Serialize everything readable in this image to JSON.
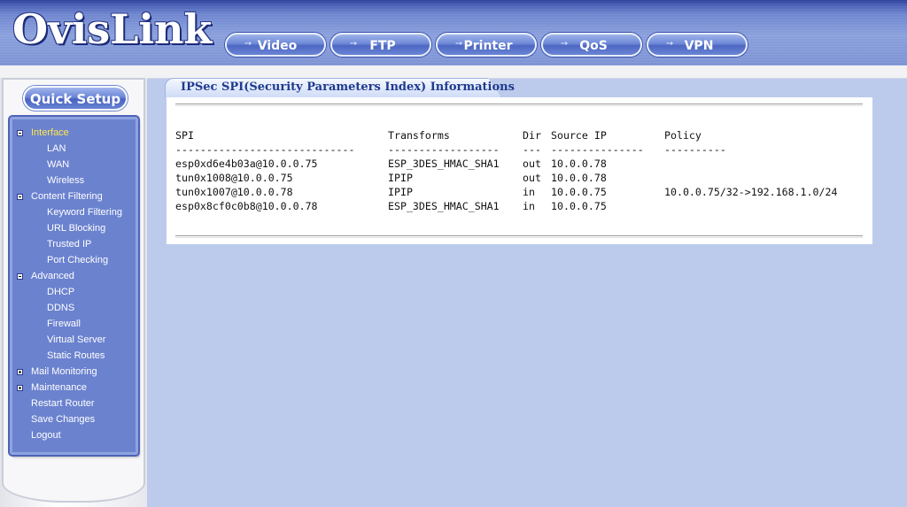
{
  "header": {
    "logo": "OvisLink",
    "nav": [
      {
        "label": "Video"
      },
      {
        "label": "FTP"
      },
      {
        "label": "Printer"
      },
      {
        "label": "QoS"
      },
      {
        "label": "VPN"
      }
    ]
  },
  "sidebar": {
    "quick_setup": "Quick Setup",
    "groups": {
      "interface": {
        "label": "Interface",
        "items": [
          "LAN",
          "WAN",
          "Wireless"
        ]
      },
      "content_filtering": {
        "label": "Content Filtering",
        "items": [
          "Keyword Filtering",
          "URL Blocking",
          "Trusted IP",
          "Port Checking"
        ]
      },
      "advanced": {
        "label": "Advanced",
        "items": [
          "DHCP",
          "DDNS",
          "Firewall",
          "Virtual Server",
          "Static Routes"
        ]
      },
      "mail_monitoring": {
        "label": "Mail Monitoring"
      },
      "maintenance": {
        "label": "Maintenance"
      }
    },
    "actions": [
      "Restart Router",
      "Save Changes",
      "Logout"
    ]
  },
  "main": {
    "title": "IPSec SPI(Security Parameters Index) Informations",
    "table": {
      "headers": {
        "spi": "SPI",
        "transforms": "Transforms",
        "dir": "Dir",
        "source_ip": "Source IP",
        "policy": "Policy"
      },
      "separators": {
        "spi": "-----------------------------",
        "transforms": "------------------",
        "dir": "---",
        "source_ip": "---------------",
        "policy": "----------"
      },
      "rows": [
        {
          "spi": "esp0xd6e4b03a@10.0.0.75",
          "transforms": "ESP_3DES_HMAC_SHA1",
          "dir": "out",
          "source_ip": "10.0.0.78",
          "policy": ""
        },
        {
          "spi": "tun0x1008@10.0.0.75",
          "transforms": "IPIP",
          "dir": "out",
          "source_ip": "10.0.0.78",
          "policy": ""
        },
        {
          "spi": "tun0x1007@10.0.0.78",
          "transforms": "IPIP",
          "dir": "in",
          "source_ip": "10.0.0.75",
          "policy": "10.0.0.75/32->192.168.1.0/24"
        },
        {
          "spi": "esp0x8cf0c0b8@10.0.0.78",
          "transforms": "ESP_3DES_HMAC_SHA1",
          "dir": "in",
          "source_ip": "10.0.0.75",
          "policy": ""
        }
      ]
    }
  },
  "colors": {
    "background": "#bccbeb",
    "menu_bg": "#6b82cf",
    "active_menu": "#ffe84a",
    "title_text": "#1f3a8f"
  },
  "icons": {
    "collapse": "minus-box-icon",
    "expand": "plus-box-icon",
    "nav_arrow": "arrow-right-icon"
  }
}
